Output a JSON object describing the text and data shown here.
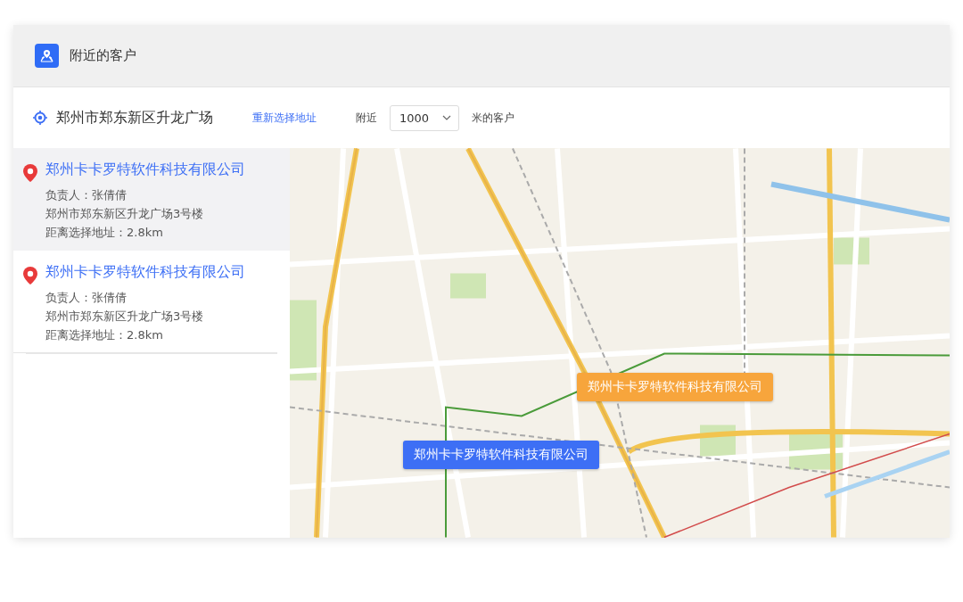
{
  "header": {
    "title": "附近的客户"
  },
  "location": {
    "address": "郑州市郑东新区升龙广场",
    "change_link": "重新选择地址",
    "nearby_label": "附近",
    "radius": "1000",
    "unit_label": "米的客户"
  },
  "customers": [
    {
      "name": "郑州卡卡罗特软件科技有限公司",
      "contact": "负责人：张倩倩",
      "address": "郑州市郑东新区升龙广场3号楼",
      "distance": "距离选择地址：2.8km",
      "selected": true
    },
    {
      "name": "郑州卡卡罗特软件科技有限公司",
      "contact": "负责人：张倩倩",
      "address": "郑州市郑东新区升龙广场3号楼",
      "distance": "距离选择地址：2.8km",
      "selected": false
    }
  ],
  "map": {
    "markers": [
      {
        "label": "郑州卡卡罗特软件科技有限公司",
        "color": "#f7a53c"
      },
      {
        "label": "郑州卡卡罗特软件科技有限公司",
        "color": "#3d6ff5"
      }
    ]
  }
}
